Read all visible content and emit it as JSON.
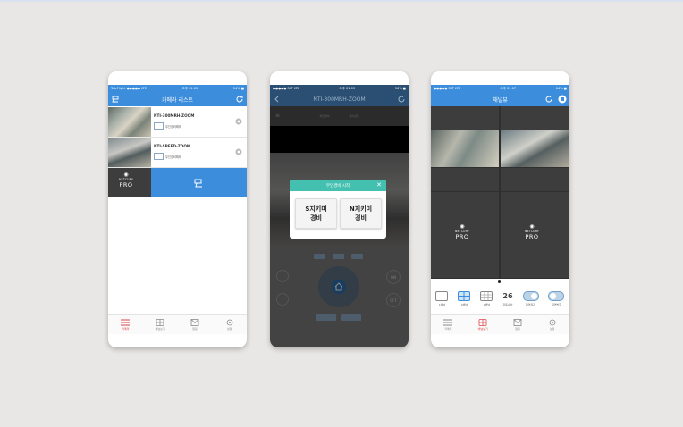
{
  "phone1": {
    "title": "카메라 리스트",
    "status_carrier": "TeleFlight ●●●●● LTE",
    "status_time": "오후 01:05",
    "status_battery": "54% ■",
    "cameras": [
      {
        "name": "NTI-300MRH-ZOOM",
        "status": "무인경비해제"
      },
      {
        "name": "NTI-SPEED-ZOOM",
        "status": "무인경비해제"
      }
    ],
    "logo_brand": "NETCURY",
    "logo_pro": "PRO",
    "tabs": [
      "카메라",
      "채널보기",
      "알림",
      "설정"
    ]
  },
  "phone2": {
    "title": "NTI-300MRH-ZOOM",
    "status_carrier": "●●●●● SKT LTE",
    "status_time": "오후 01:03",
    "status_battery": "56% ■",
    "top_labels": [
      "화면캡쳐",
      "경비설정"
    ],
    "popup_title": "무인경비 시작",
    "popup_close": "✕",
    "btn_s_line1": "S지키미",
    "btn_s_line2": "경비",
    "btn_n_line1": "N지키미",
    "btn_n_line2": "경비",
    "on_label": "ON",
    "off_label": "OFF"
  },
  "phone3": {
    "title": "채널뷰",
    "status_carrier": "●●●●● SKT LTE",
    "status_time": "오후 01:07",
    "status_battery": "64% ■",
    "logo_brand": "NETCURY",
    "logo_pro": "PRO",
    "controls": [
      {
        "label": "1채널",
        "icon": "single-screen-icon"
      },
      {
        "label": "4채널",
        "icon": "quad-screen-icon"
      },
      {
        "label": "9채널",
        "icon": "nine-screen-icon"
      },
      {
        "label": "자동순차",
        "value": "26",
        "icon": "number-display"
      },
      {
        "label": "화면유지",
        "icon": "toggle-icon"
      },
      {
        "label": "화면방향",
        "icon": "toggle-icon"
      }
    ],
    "tabs": [
      "카메라",
      "채널보기",
      "알림",
      "설정"
    ]
  },
  "colors": {
    "blue": "#3c8edd",
    "teal": "#43c0b0",
    "red": "#e0464a"
  }
}
